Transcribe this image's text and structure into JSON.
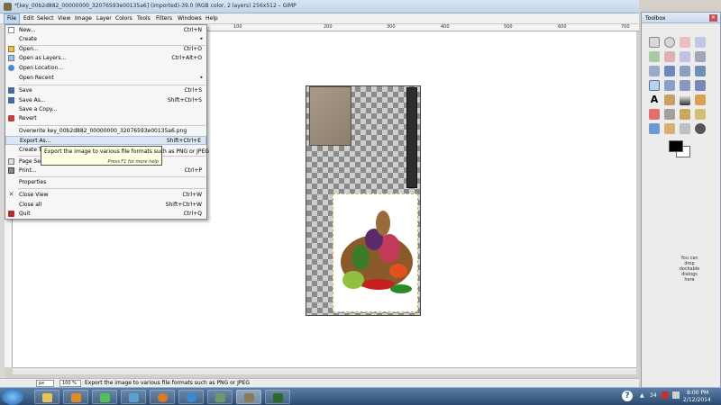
{
  "window": {
    "title": "*[key_00b2d882_00000000_32076593e00135a6] (imported)-39.0 (RGB color, 2 layers) 256x512 – GIMP"
  },
  "menubar": {
    "items": [
      "File",
      "Edit",
      "Select",
      "View",
      "Image",
      "Layer",
      "Colors",
      "Tools",
      "Filters",
      "Windows",
      "Help"
    ]
  },
  "ruler": {
    "ticks": [
      "100",
      "200",
      "300",
      "400",
      "500",
      "600",
      "700"
    ]
  },
  "file_menu": {
    "items": [
      {
        "label": "New...",
        "shortcut": "Ctrl+N",
        "icon": "new-icon"
      },
      {
        "label": "Create",
        "shortcut": "",
        "submenu": true
      },
      {
        "label": "Open...",
        "shortcut": "Ctrl+O",
        "icon": "open-icon"
      },
      {
        "label": "Open as Layers...",
        "shortcut": "Ctrl+Alt+O",
        "icon": "open-layers-icon"
      },
      {
        "label": "Open Location...",
        "shortcut": "",
        "icon": "globe-icon"
      },
      {
        "label": "Open Recent",
        "shortcut": "",
        "submenu": true
      },
      {
        "label": "Save",
        "shortcut": "Ctrl+S",
        "icon": "save-icon"
      },
      {
        "label": "Save As...",
        "shortcut": "Shift+Ctrl+S",
        "icon": "save-as-icon"
      },
      {
        "label": "Save a Copy...",
        "shortcut": ""
      },
      {
        "label": "Revert",
        "shortcut": "",
        "icon": "revert-icon"
      },
      {
        "label": "Overwrite key_00b2d882_00000000_32076593e00135a6.png",
        "shortcut": ""
      },
      {
        "label": "Export As...",
        "shortcut": "Shift+Ctrl+E"
      },
      {
        "label": "Create Template...",
        "shortcut": ""
      },
      {
        "label": "Page Setup...",
        "shortcut": "",
        "icon": "page-setup-icon"
      },
      {
        "label": "Print...",
        "shortcut": "Ctrl+P",
        "icon": "print-icon"
      },
      {
        "label": "Properties",
        "shortcut": ""
      },
      {
        "label": "Close View",
        "shortcut": "Ctrl+W",
        "icon": "close-view-icon"
      },
      {
        "label": "Close all",
        "shortcut": "Shift+Ctrl+W"
      },
      {
        "label": "Quit",
        "shortcut": "Ctrl+Q",
        "icon": "quit-icon"
      }
    ]
  },
  "tooltip": {
    "text": "Export the image to various file formats such as PNG or JPEG",
    "hint": "Press F1 for more help"
  },
  "statusbar": {
    "unit": "px",
    "zoom": "100 %",
    "message": "Export the image to various file formats such as PNG or JPEG"
  },
  "toolbox": {
    "title": "Toolbox",
    "drop_hint": "You can drop dockable dialogs here"
  },
  "taskbar": {
    "time": "8:00 PM",
    "date": "2/12/2014",
    "badge": "34"
  },
  "colors": {
    "menu_highlight": "#dbe6f4",
    "tooltip_bg": "#ffffe1",
    "foreground": "#000000",
    "background": "#ffffff"
  }
}
